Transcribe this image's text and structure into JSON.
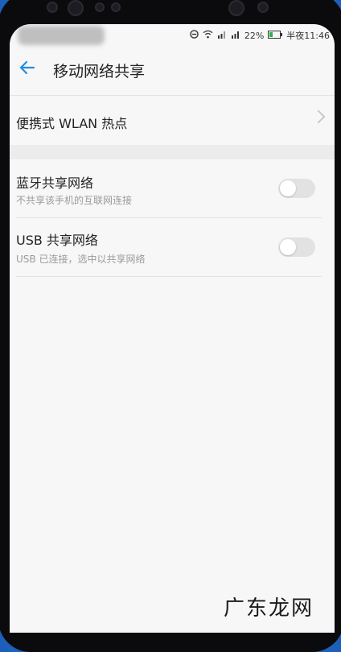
{
  "status": {
    "battery": "22%",
    "time": "半夜11:46",
    "icons": [
      "dnd-icon",
      "wifi-icon",
      "signal-icon",
      "signal-icon",
      "battery-icon"
    ]
  },
  "header": {
    "title": "移动网络共享",
    "back_icon": "arrow-left-icon"
  },
  "items": [
    {
      "title": "便携式 WLAN 热点",
      "chevron": "chevron-right-icon"
    },
    {
      "title": "蓝牙共享网络",
      "subtitle": "不共享该手机的互联网连接",
      "toggle": "off"
    },
    {
      "title": "USB 共享网络",
      "subtitle": "USB 已连接，选中以共享网络",
      "toggle": "off"
    }
  ],
  "watermark": "广东龙网",
  "colors": {
    "accent": "#1f8fe0",
    "background": "#f7f7f7"
  }
}
